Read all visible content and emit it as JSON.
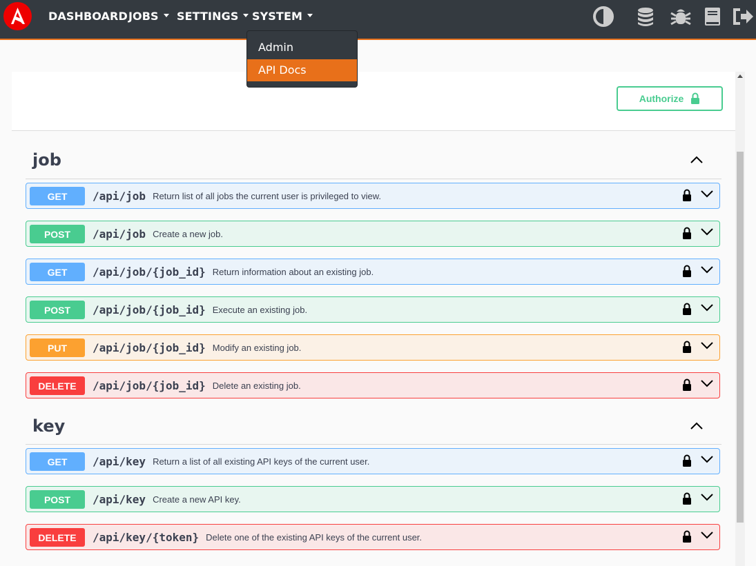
{
  "nav": {
    "items": [
      {
        "label": "DASHBOARD",
        "dropdown": false
      },
      {
        "label": "JOBS",
        "dropdown": true
      },
      {
        "label": "SETTINGS",
        "dropdown": true
      },
      {
        "label": "SYSTEM",
        "dropdown": true
      }
    ],
    "icons": [
      "contrast-icon",
      "database-icon",
      "bug-icon",
      "book-icon",
      "logout-icon"
    ]
  },
  "system_menu": {
    "items": [
      {
        "label": "Admin",
        "active": false
      },
      {
        "label": "API Docs",
        "active": true
      }
    ]
  },
  "authorize": {
    "label": "Authorize"
  },
  "sections": [
    {
      "name": "job",
      "operations": [
        {
          "method": "GET",
          "path": "/api/job",
          "summary": "Return list of all jobs the current user is privileged to view."
        },
        {
          "method": "POST",
          "path": "/api/job",
          "summary": "Create a new job."
        },
        {
          "method": "GET",
          "path": "/api/job/{job_id}",
          "summary": "Return information about an existing job."
        },
        {
          "method": "POST",
          "path": "/api/job/{job_id}",
          "summary": "Execute an existing job."
        },
        {
          "method": "PUT",
          "path": "/api/job/{job_id}",
          "summary": "Modify an existing job."
        },
        {
          "method": "DELETE",
          "path": "/api/job/{job_id}",
          "summary": "Delete an existing job."
        }
      ]
    },
    {
      "name": "key",
      "operations": [
        {
          "method": "GET",
          "path": "/api/key",
          "summary": "Return a list of all existing API keys of the current user."
        },
        {
          "method": "POST",
          "path": "/api/key",
          "summary": "Create a new API key."
        },
        {
          "method": "DELETE",
          "path": "/api/key/{token}",
          "summary": "Delete one of the existing API keys of the current user."
        }
      ]
    }
  ],
  "colors": {
    "navbar": "#343a40",
    "accent": "#e8701a",
    "get": "#61affe",
    "post": "#49cc90",
    "put": "#fca130",
    "delete": "#f93e3e"
  }
}
